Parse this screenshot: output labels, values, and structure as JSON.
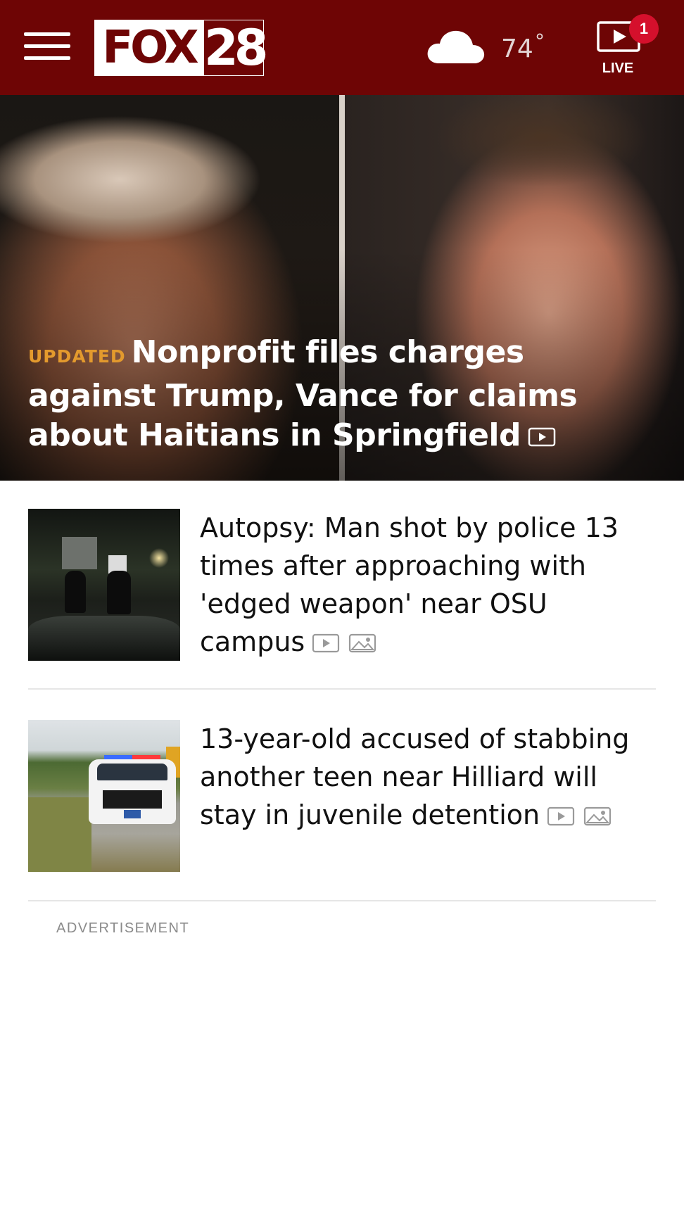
{
  "header": {
    "brand_word": "FOX",
    "brand_number": "28",
    "weather": {
      "temperature": "74",
      "degree_symbol": "°",
      "icon": "cloud-icon"
    },
    "live": {
      "label": "LIVE",
      "badge_count": "1",
      "icon": "live-video-icon"
    },
    "colors": {
      "header_bg": "#6e0505",
      "badge_bg": "#d5102c",
      "updated_tag": "#e39a2d"
    }
  },
  "hero": {
    "tag": "UPDATED",
    "headline": "Nonprofit files charges against Trump, Vance for claims about Haitians in Springfield",
    "media_icons": [
      "video-icon"
    ]
  },
  "stories": [
    {
      "headline": "Autopsy: Man shot by police 13 times after approaching with 'edged weapon' near OSU campus",
      "media_icons": [
        "video-icon",
        "photo-gallery-icon"
      ]
    },
    {
      "headline": "13-year-old accused of stabbing another teen near Hilliard will stay in juvenile detention",
      "media_icons": [
        "video-icon",
        "photo-gallery-icon"
      ]
    }
  ],
  "advertisement": {
    "label": "ADVERTISEMENT"
  }
}
